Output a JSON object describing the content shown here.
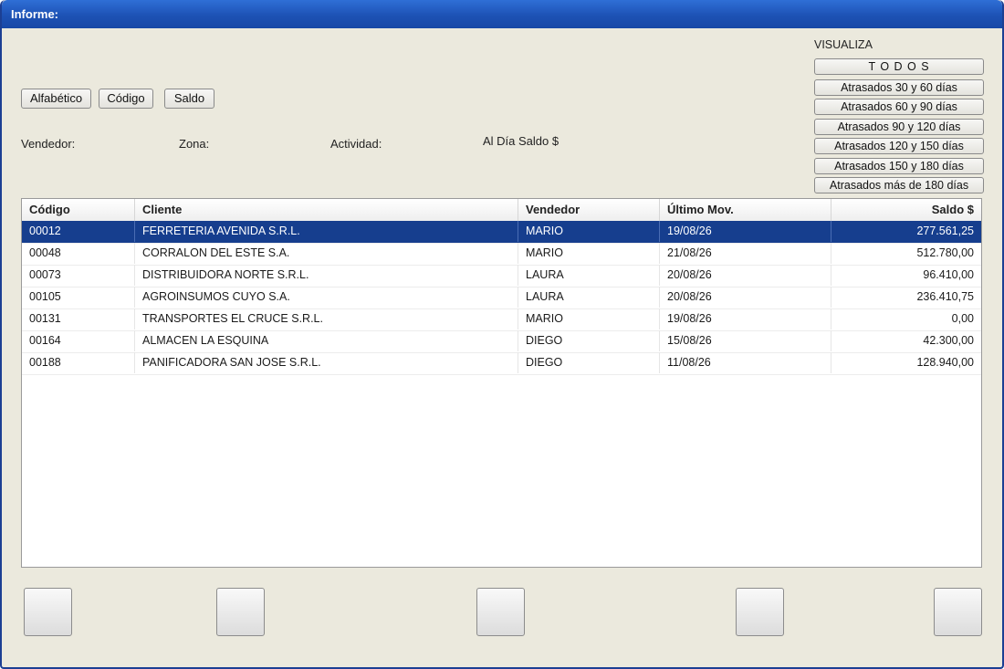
{
  "window": {
    "title": "Informe:"
  },
  "sort_buttons": [
    "Alfabético",
    "Código",
    "Saldo"
  ],
  "filters": {
    "heading": "VISUALIZA",
    "options": [
      "T O D O S",
      "Atrasados 30 y 60 días",
      "Atrasados 60 y 90 días",
      "Atrasados 90 y 120 días",
      "Atrasados 120 y 150 días",
      "Atrasados 150 y 180 días",
      "Atrasados más de 180 días"
    ]
  },
  "labels": {
    "vendedor": "Vendedor:",
    "zona": "Zona:",
    "actividad": "Actividad:",
    "al_dia": "Al Día Saldo $"
  },
  "table": {
    "columns": [
      "Código",
      "Cliente",
      "Vendedor",
      "Último Mov.",
      "Saldo $"
    ],
    "rows": [
      [
        "00012",
        "FERRETERIA AVENIDA S.R.L.",
        "MARIO",
        "19/08/26",
        "277.561,25"
      ],
      [
        "00048",
        "CORRALON DEL ESTE S.A.",
        "MARIO",
        "21/08/26",
        "512.780,00"
      ],
      [
        "00073",
        "DISTRIBUIDORA NORTE S.R.L.",
        "LAURA",
        "20/08/26",
        "96.410,00"
      ],
      [
        "00105",
        "AGROINSUMOS CUYO S.A.",
        "LAURA",
        "20/08/26",
        "236.410,75"
      ],
      [
        "00131",
        "TRANSPORTES EL CRUCE S.R.L.",
        "MARIO",
        "19/08/26",
        "0,00"
      ],
      [
        "00164",
        "ALMACEN LA ESQUINA",
        "DIEGO",
        "15/08/26",
        "42.300,00"
      ],
      [
        "00188",
        "PANIFICADORA SAN JOSE S.R.L.",
        "DIEGO",
        "11/08/26",
        "128.940,00"
      ]
    ],
    "selected_row": 0
  },
  "colors": {
    "titlebar": "#1d52b5",
    "background": "#ebe9dd",
    "selection": "#163e8e"
  }
}
